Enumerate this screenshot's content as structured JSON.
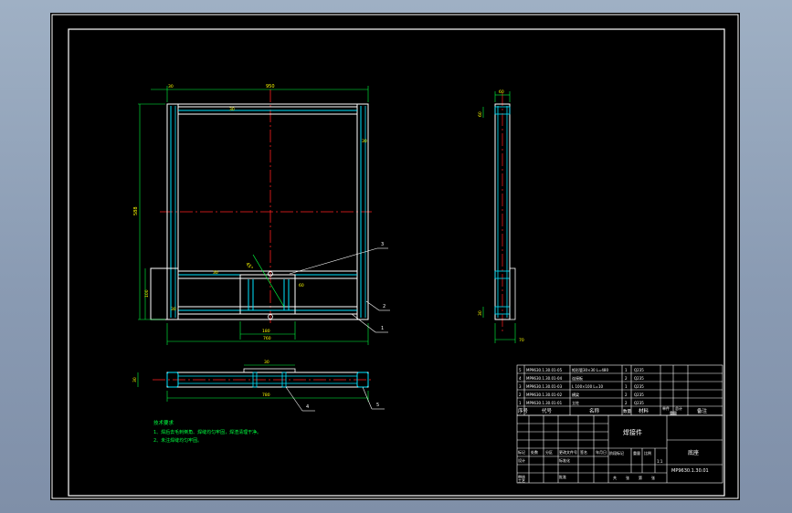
{
  "colors": {
    "background": "#8fa0b8",
    "sheet": "#000000",
    "border": "#ffffff",
    "geometry": "#ffffff",
    "profile": "#00e5ff",
    "centerline": "#ff2020",
    "dimension": "#00ff40",
    "dimension_text": "#ffff00",
    "notes": "#00ff40"
  },
  "front_view": {
    "top_dim": "950",
    "top_left_dim": "30",
    "left_height_dim": "588",
    "left_lower_dim": "100",
    "angle_dim": "45°",
    "bottom_dims": [
      "180",
      "760"
    ],
    "labels": {
      "l1": "30",
      "l2": "30",
      "l3": "30",
      "l4": "60"
    }
  },
  "top_view": {
    "top_label": "30",
    "left_label": "30",
    "bottom_dim": "780"
  },
  "side_view": {
    "top_dim": "60",
    "bottom_dim": "70",
    "left_dims": [
      "60",
      "30"
    ]
  },
  "balloons": [
    "3",
    "2",
    "1",
    "4",
    "5"
  ],
  "notes": {
    "title": "技术要求",
    "lines": [
      "1、焊后去毛刺倒角、焊缝均匀牢固，焊渣清理干净。",
      "2、未注焊缝均匀牢固。"
    ]
  },
  "parts_list": {
    "rows": [
      [
        "5",
        "MP9630.1.30.01-05",
        "矩形管30×30 L=480",
        "1",
        "Q235"
      ],
      [
        "4",
        "MP9630.1.30.01-04",
        "连接板",
        "2",
        "Q235"
      ],
      [
        "3",
        "MP9630.1.30.01-03",
        "L 100×100 L=10",
        "1",
        "Q235"
      ],
      [
        "2",
        "MP9630.1.30.01-02",
        "横梁",
        "2",
        "Q235"
      ],
      [
        "1",
        "MP9630.1.30.01-01",
        "立柱",
        "2",
        "Q235"
      ]
    ],
    "header": [
      "序号",
      "代号",
      "名称",
      "数量",
      "材料",
      "单件",
      "总计",
      "备注"
    ],
    "header_sub": "重量"
  },
  "title_block": {
    "title": "焊接件",
    "company": "底座",
    "drawing_no": "MP9630.1.30.01",
    "scale": "1:1",
    "fields": [
      "标记",
      "处数",
      "分区",
      "更改文件号",
      "签名",
      "年月日"
    ],
    "stage_label": "阶段标记",
    "weight_label": "重量",
    "scale_label": "比例",
    "sheet_labels": [
      "共",
      "张",
      "第",
      "张"
    ],
    "roles": [
      "设计",
      "审核",
      "工艺",
      "标准化",
      "批准"
    ]
  }
}
